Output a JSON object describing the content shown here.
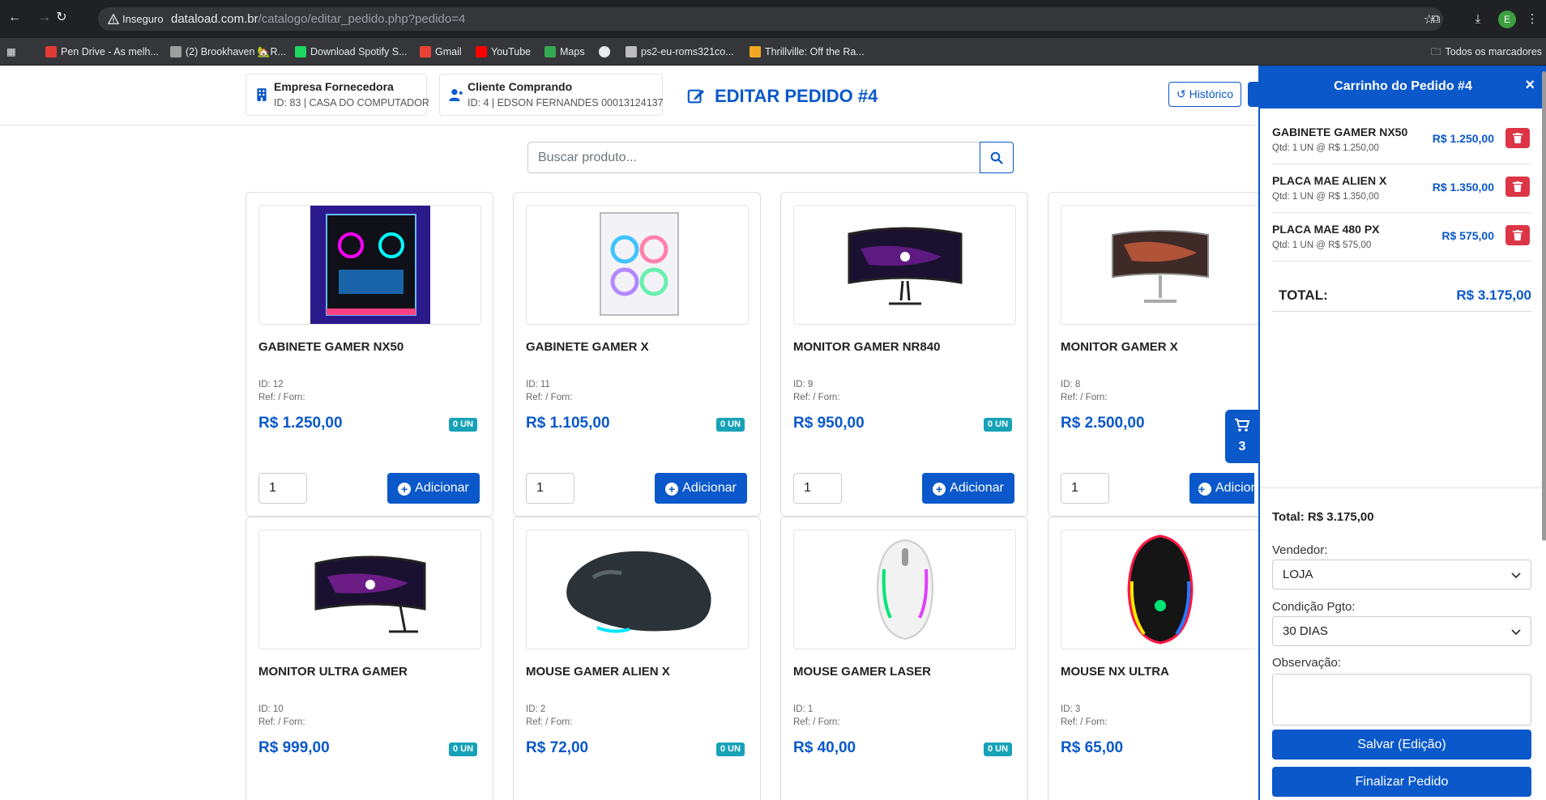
{
  "browser": {
    "insecure_label": "Inseguro",
    "url_host": "dataload.com.br",
    "url_path": "/catalogo/editar_pedido.php?pedido=4",
    "profile_initial": "E",
    "bookmarks": [
      {
        "label": "Pen Drive - As melh...",
        "color": "#e53935"
      },
      {
        "label": "(2) Brookhaven 🏡R...",
        "color": "#9e9e9e"
      },
      {
        "label": "Download Spotify S...",
        "color": "#1ed760"
      },
      {
        "label": "Gmail",
        "color": "#ea4335"
      },
      {
        "label": "YouTube",
        "color": "#ff0000"
      },
      {
        "label": "Maps",
        "color": "#34a853"
      },
      {
        "label": "",
        "color": "#e8eaed"
      },
      {
        "label": "ps2-eu-roms321co...",
        "color": "#bdbdbd"
      },
      {
        "label": "Thrillville: Off the Ra...",
        "color": "#f5a623"
      }
    ],
    "all_bookmarks": "Todos os marcadores"
  },
  "header": {
    "supplier_title": "Empresa Fornecedora",
    "supplier_detail": "ID: 83 | CASA DO COMPUTADOR",
    "client_title": "Cliente Comprando",
    "client_detail": "ID: 4 | EDSON FERNANDES 00013124137",
    "page_title": "EDITAR PEDIDO #4",
    "history_label": "Histórico"
  },
  "search": {
    "placeholder": "Buscar produto..."
  },
  "products": [
    {
      "name": "GABINETE GAMER NX50",
      "id": "ID: 12",
      "ref": "Ref: / Forn:",
      "price": "R$ 1.250,00",
      "stock": "0 UN",
      "qty": "1",
      "add": "Adicionar"
    },
    {
      "name": "GABINETE GAMER X",
      "id": "ID: 11",
      "ref": "Ref: / Forn:",
      "price": "R$ 1.105,00",
      "stock": "0 UN",
      "qty": "1",
      "add": "Adicionar"
    },
    {
      "name": "MONITOR GAMER NR840",
      "id": "ID: 9",
      "ref": "Ref: / Forn:",
      "price": "R$ 950,00",
      "stock": "0 UN",
      "qty": "1",
      "add": "Adicionar"
    },
    {
      "name": "MONITOR GAMER X",
      "id": "ID: 8",
      "ref": "Ref: / Forn:",
      "price": "R$ 2.500,00",
      "stock": "",
      "qty": "1",
      "add": "Adicionar"
    },
    {
      "name": "MONITOR ULTRA GAMER",
      "id": "ID: 10",
      "ref": "Ref: / Forn:",
      "price": "R$ 999,00",
      "stock": "0 UN"
    },
    {
      "name": "MOUSE GAMER ALIEN X",
      "id": "ID: 2",
      "ref": "Ref: / Forn:",
      "price": "R$ 72,00",
      "stock": "0 UN"
    },
    {
      "name": "MOUSE GAMER LASER",
      "id": "ID: 1",
      "ref": "Ref: / Forn:",
      "price": "R$ 40,00",
      "stock": "0 UN"
    },
    {
      "name": "MOUSE NX ULTRA",
      "id": "ID: 3",
      "ref": "Ref: / Forn:",
      "price": "R$ 65,00",
      "stock": ""
    }
  ],
  "floating_cart": {
    "count": "3"
  },
  "cart": {
    "title": "Carrinho do Pedido #4",
    "close": "×",
    "items": [
      {
        "name": "GABINETE GAMER NX50",
        "qty_line": "Qtd: 1 UN @ R$ 1.250,00",
        "price": "R$ 1.250,00"
      },
      {
        "name": "PLACA MAE ALIEN X",
        "qty_line": "Qtd: 1 UN @ R$ 1.350,00",
        "price": "R$ 1.350,00"
      },
      {
        "name": "PLACA MAE 480 PX",
        "qty_line": "Qtd: 1 UN @ R$ 575,00",
        "price": "R$ 575,00"
      }
    ],
    "total_label": "TOTAL:",
    "total_value": "R$ 3.175,00",
    "footer_total": "Total: R$ 3.175,00",
    "seller_label": "Vendedor:",
    "seller_value": "LOJA",
    "payment_label": "Condição Pgto:",
    "payment_value": "30 DIAS",
    "notes_label": "Observação:",
    "save_button": "Salvar (Edição)",
    "finish_button": "Finalizar Pedido"
  },
  "colors": {
    "primary": "#0a58ca",
    "danger": "#dc3545",
    "info": "#17a2b8"
  }
}
